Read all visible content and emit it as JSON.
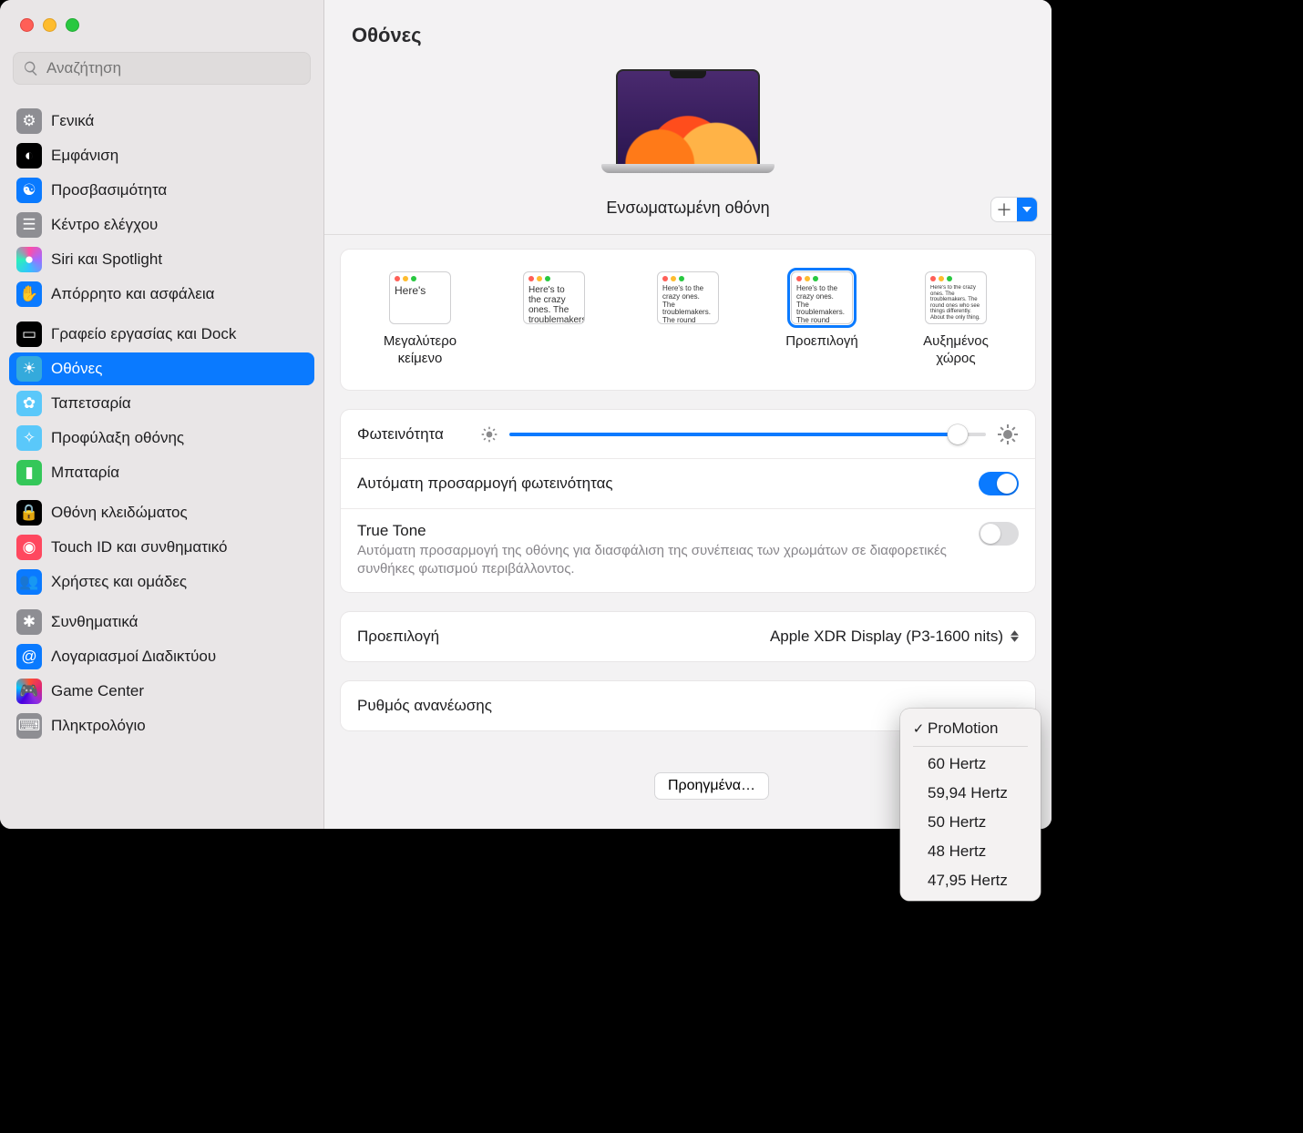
{
  "window_title": "Οθόνες",
  "search_placeholder": "Αναζήτηση",
  "display_name": "Ενσωματωμένη οθόνη",
  "sidebar": {
    "items": [
      {
        "id": "general",
        "label": "Γενικά",
        "bg": "#8e8e93",
        "icon": "gear"
      },
      {
        "id": "appearance",
        "label": "Εμφάνιση",
        "bg": "#000000",
        "icon": "contrast"
      },
      {
        "id": "accessibility",
        "label": "Προσβασιμότητα",
        "bg": "#0a7aff",
        "icon": "person"
      },
      {
        "id": "control-center",
        "label": "Κέντρο ελέγχου",
        "bg": "#8e8e93",
        "icon": "sliders"
      },
      {
        "id": "siri",
        "label": "Siri και Spotlight",
        "bg": "#e056d5",
        "icon": "siri"
      },
      {
        "id": "privacy",
        "label": "Απόρρητο και ασφάλεια",
        "bg": "#0a7aff",
        "icon": "hand"
      },
      {
        "id": "desktop-dock",
        "label": "Γραφείο εργασίας και Dock",
        "bg": "#000000",
        "icon": "dock"
      },
      {
        "id": "displays",
        "label": "Οθόνες",
        "bg": "#34aadc",
        "icon": "brightness",
        "selected": true
      },
      {
        "id": "wallpaper",
        "label": "Ταπετσαρία",
        "bg": "#5ac8fa",
        "icon": "flower"
      },
      {
        "id": "screensaver",
        "label": "Προφύλαξη οθόνης",
        "bg": "#5ac8fa",
        "icon": "sparkle"
      },
      {
        "id": "battery",
        "label": "Μπαταρία",
        "bg": "#34c759",
        "icon": "battery"
      },
      {
        "id": "lock-screen",
        "label": "Οθόνη κλειδώματος",
        "bg": "#000000",
        "icon": "lock"
      },
      {
        "id": "touchid",
        "label": "Touch ID και συνθηματικό",
        "bg": "#ff485f",
        "icon": "fingerprint"
      },
      {
        "id": "users",
        "label": "Χρήστες και ομάδες",
        "bg": "#0a7aff",
        "icon": "people"
      },
      {
        "id": "passwords",
        "label": "Συνθηματικά",
        "bg": "#8e8e93",
        "icon": "key"
      },
      {
        "id": "internet-accounts",
        "label": "Λογαριασμοί Διαδικτύου",
        "bg": "#0a7aff",
        "icon": "at"
      },
      {
        "id": "game-center",
        "label": "Game Center",
        "bg": "#ff3b30",
        "icon": "gc"
      },
      {
        "id": "keyboard",
        "label": "Πληκτρολόγιο",
        "bg": "#8e8e93",
        "icon": "keyboard"
      }
    ],
    "sections": [
      [
        0,
        1,
        2,
        3,
        4,
        5
      ],
      [
        6,
        7,
        8,
        9,
        10
      ],
      [
        11,
        12,
        13
      ],
      [
        14,
        15,
        16,
        17
      ]
    ]
  },
  "scaling": {
    "options": [
      {
        "id": "larger",
        "label": "Μεγαλύτερο\nκείμενο",
        "size": "txtL"
      },
      {
        "id": "mid1",
        "label": "",
        "size": "txtM"
      },
      {
        "id": "mid2",
        "label": "",
        "size": "txtS"
      },
      {
        "id": "default",
        "label": "Προεπιλογή",
        "size": "txtS",
        "selected": true
      },
      {
        "id": "more-space",
        "label": "Αυξημένος\nχώρος",
        "size": "txtXS"
      }
    ],
    "sample_text": "Here's to the crazy ones. The troublemakers. The round ones who see things differently. About the only thing."
  },
  "rows": {
    "brightness_label": "Φωτεινότητα",
    "auto_brightness_label": "Αυτόματη προσαρμογή φωτεινότητας",
    "true_tone_label": "True Tone",
    "true_tone_sub": "Αυτόματη προσαρμογή της οθόνης για διασφάλιση της συνέπειας των χρωμάτων σε διαφορετικές συνθήκες φωτισμού περιβάλλοντος.",
    "preset_label": "Προεπιλογή",
    "preset_value": "Apple XDR Display (P3-1600 nits)",
    "refresh_label": "Ρυθμός ανανέωσης"
  },
  "advanced_button": "Προηγμένα…",
  "refresh_menu": {
    "selected": "ProMotion",
    "options": [
      "ProMotion",
      "60 Hertz",
      "59,94 Hertz",
      "50 Hertz",
      "48 Hertz",
      "47,95 Hertz"
    ]
  },
  "brightness_pct": 94,
  "auto_brightness_on": true,
  "true_tone_on": false
}
